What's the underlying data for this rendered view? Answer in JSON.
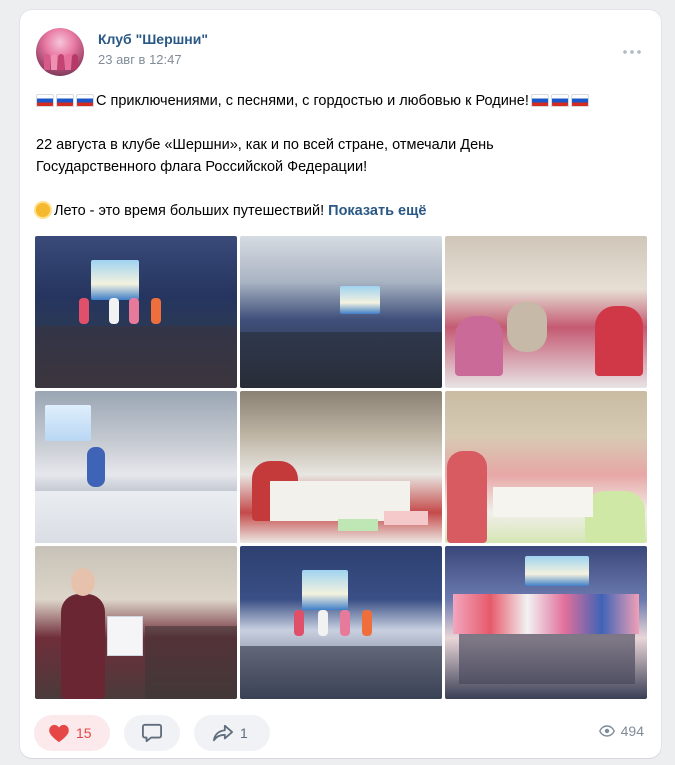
{
  "post": {
    "author": "Клуб \"Шершни\"",
    "time": "23 авг в 12:47",
    "more_icon": "more-horizontal-icon",
    "lines": {
      "title": "С приключениями, с песнями, с гордостью и любовью к Родине!",
      "body1": "22 августа в клубе «Шершни», как и по всей стране, отмечали День",
      "body2": "Государственного флага Российской Федерации!",
      "teaser": "Лето - это время больших путешествий!",
      "show_more": "Показать ещё"
    },
    "photo_count": 9,
    "colors": {
      "link": "#2a5885",
      "like": "#e64646",
      "muted": "#818c99"
    }
  },
  "actions": {
    "likes": "15",
    "comment_icon": "comment-icon",
    "shares": "1",
    "views": "494"
  }
}
